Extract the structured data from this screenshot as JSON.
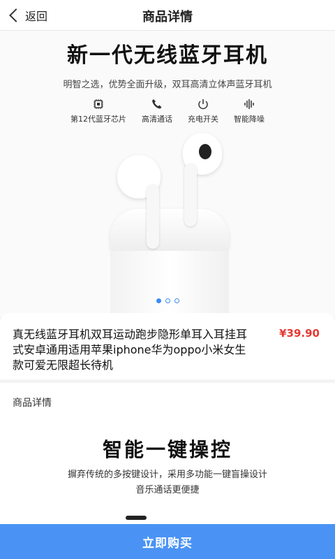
{
  "header": {
    "back_label": "返回",
    "title": "商品详情"
  },
  "hero": {
    "headline": "新一代无线蓝牙耳机",
    "subline": "明智之选，优势全面升级，双耳高清立体声蓝牙耳机",
    "features": [
      {
        "label": "第12代蓝牙芯片",
        "icon": "chip-icon"
      },
      {
        "label": "高清通话",
        "icon": "phone-icon"
      },
      {
        "label": "充电开关",
        "icon": "power-icon"
      },
      {
        "label": "智能降噪",
        "icon": "soundwave-icon"
      }
    ],
    "carousel": {
      "total": 3,
      "active_index": 0
    }
  },
  "product": {
    "name": "真无线蓝牙耳机双耳运动跑步隐形单耳入耳挂耳式安卓通用适用苹果iphone华为oppo小米女生款可爱无限超长待机",
    "price": "¥39.90"
  },
  "detail": {
    "section_label": "商品详情",
    "title": "智能一键操控",
    "line1": "摒弃传统的多按键设计，采用多功能一键盲操设计",
    "line2": "音乐通话更便捷"
  },
  "bottom_bar": {
    "buy_label": "立即购买"
  },
  "colors": {
    "accent": "#4a93f5",
    "price": "#e53935"
  }
}
